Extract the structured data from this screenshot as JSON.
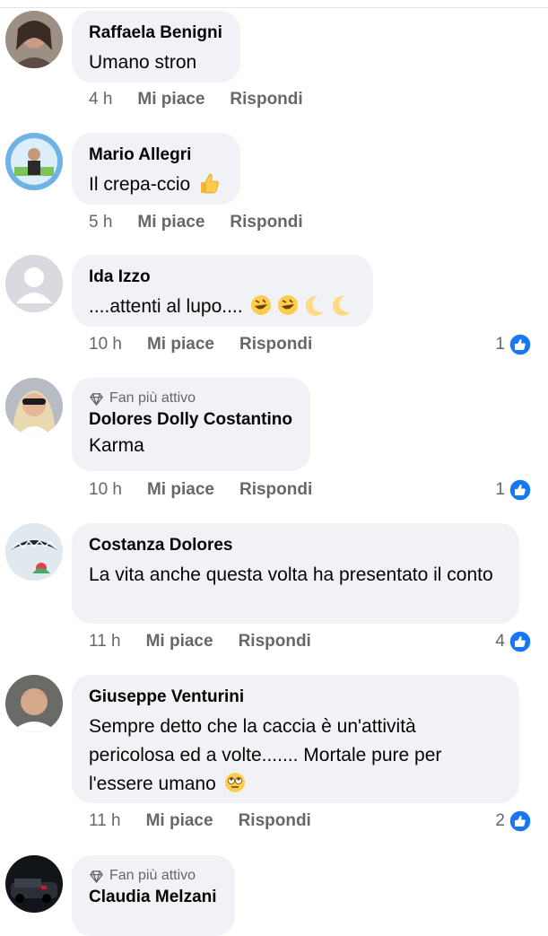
{
  "comments": [
    {
      "name": "Raffaela Benigni",
      "text": "Umano stron",
      "time": "4 h",
      "like_label": "Mi piace",
      "reply_label": "Rispondi",
      "badge": "",
      "reactions": ""
    },
    {
      "name": "Mario Allegri",
      "text": "Il crepa-ccio",
      "emoji": "thumbs-up",
      "time": "5 h",
      "like_label": "Mi piace",
      "reply_label": "Rispondi",
      "badge": "",
      "reactions": ""
    },
    {
      "name": "Ida Izzo",
      "text": "....attenti al lupo....",
      "emoji": "rofl-rofl-moon-moon",
      "time": "10 h",
      "like_label": "Mi piace",
      "reply_label": "Rispondi",
      "badge": "",
      "reactions": "1"
    },
    {
      "name": "Dolores Dolly Costantino",
      "text": "Karma",
      "time": "10 h",
      "like_label": "Mi piace",
      "reply_label": "Rispondi",
      "badge": "Fan più attivo",
      "reactions": "1"
    },
    {
      "name": "Costanza Dolores",
      "text": "La vita anche questa volta ha presentato il conto",
      "time": "11 h",
      "like_label": "Mi piace",
      "reply_label": "Rispondi",
      "badge": "",
      "reactions": "4"
    },
    {
      "name": "Giuseppe Venturini",
      "text": "Sempre detto che la caccia è un'attività pericolosa ed a volte....... Mortale pure per l'essere umano",
      "emoji": "eye-roll",
      "time": "11 h",
      "like_label": "Mi piace",
      "reply_label": "Rispondi",
      "badge": "",
      "reactions": "2"
    },
    {
      "name": "Claudia Melzani",
      "text": "",
      "time": "",
      "like_label": "",
      "reply_label": "",
      "badge": "Fan più attivo",
      "reactions": ""
    }
  ],
  "colors": {
    "bubble": "#f0f2f5",
    "meta": "#65676b",
    "like_blue": "#1877f2"
  }
}
